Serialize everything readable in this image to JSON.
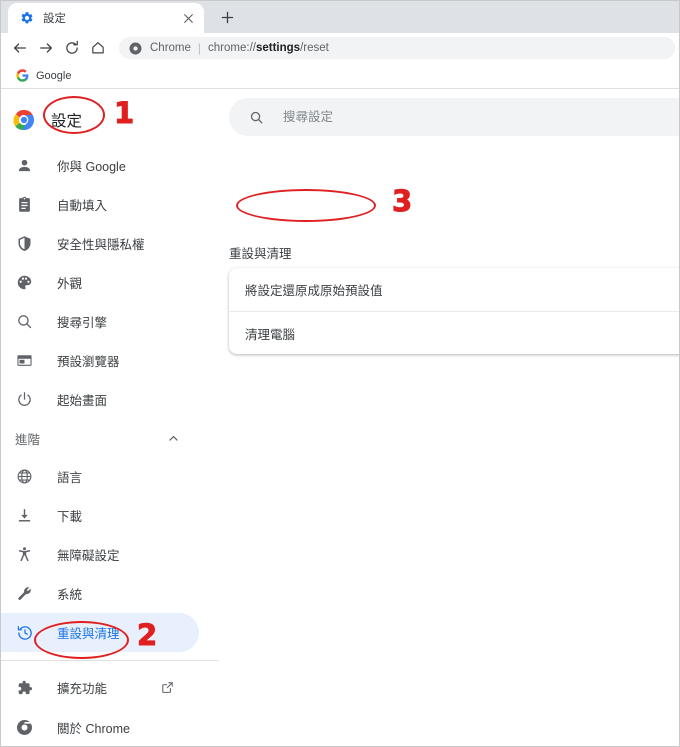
{
  "browser": {
    "tab": {
      "title": "設定",
      "favicon": "gear-icon",
      "close": "×"
    },
    "newtab_label": "+",
    "toolbar": {
      "back": "back-arrow-icon",
      "forward": "forward-arrow-icon",
      "reload": "reload-icon",
      "home": "home-icon"
    },
    "omnibox": {
      "chip": "Chrome",
      "separator": "|",
      "url_prefix": "chrome://",
      "url_bold": "settings",
      "url_suffix": "/reset",
      "full_url": "chrome://settings/reset"
    },
    "bookmarks": [
      {
        "label": "Google",
        "icon": "google-g-icon"
      }
    ]
  },
  "settings": {
    "brand_title": "設定",
    "search": {
      "placeholder": "搜尋設定",
      "value": "",
      "icon": "search-icon"
    },
    "sidebar": {
      "items": [
        {
          "label": "你與 Google",
          "icon": "person-icon",
          "active": false
        },
        {
          "label": "自動填入",
          "icon": "clipboard-icon",
          "active": false
        },
        {
          "label": "安全性與隱私權",
          "icon": "shield-icon",
          "active": false
        },
        {
          "label": "外觀",
          "icon": "palette-icon",
          "active": false
        },
        {
          "label": "搜尋引擎",
          "icon": "search-icon",
          "active": false
        },
        {
          "label": "預設瀏覽器",
          "icon": "browser-window-icon",
          "active": false
        },
        {
          "label": "起始畫面",
          "icon": "power-icon",
          "active": false
        }
      ],
      "advanced_section": {
        "label": "進階",
        "expanded": true,
        "chevron": "chevron-up-icon"
      },
      "advanced_items": [
        {
          "label": "語言",
          "icon": "globe-icon",
          "active": false
        },
        {
          "label": "下載",
          "icon": "download-icon",
          "active": false
        },
        {
          "label": "無障礙設定",
          "icon": "accessibility-icon",
          "active": false
        },
        {
          "label": "系統",
          "icon": "wrench-icon",
          "active": false
        },
        {
          "label": "重設與清理",
          "icon": "restore-clock-icon",
          "active": true
        }
      ],
      "footer_items": [
        {
          "label": "擴充功能",
          "icon": "puzzle-icon",
          "external": true,
          "external_icon": "open-in-new-icon"
        },
        {
          "label": "關於 Chrome",
          "icon": "chrome-logo-icon",
          "external": false
        }
      ]
    },
    "main": {
      "section_title": "重設與清理",
      "rows": [
        {
          "label": "將設定還原成原始預設值"
        },
        {
          "label": "清理電腦"
        }
      ]
    }
  },
  "annotations": {
    "accent_color": "#e02020",
    "markers": [
      {
        "number": "1",
        "target": "settings-brand-title"
      },
      {
        "number": "2",
        "target": "sidebar-item-reset-and-clean"
      },
      {
        "number": "3",
        "target": "restore-settings-row"
      }
    ]
  },
  "colors": {
    "active_pill_bg": "#e8f0fe",
    "active_text": "#1a73e8",
    "tabstrip_bg": "#dee1e6",
    "search_bg": "#f1f3f4",
    "text_primary": "#3c4043",
    "text_secondary": "#5f6368"
  }
}
